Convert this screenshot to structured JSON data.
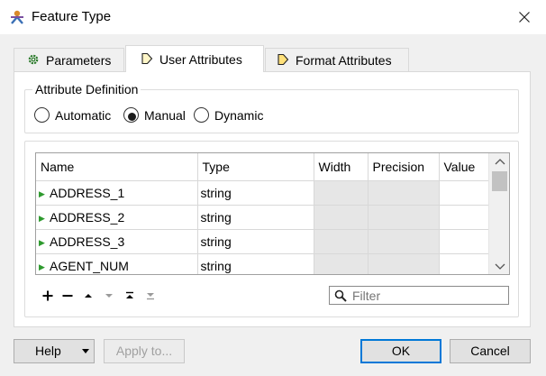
{
  "window": {
    "title": "Feature Type",
    "app_icon": "fme-workbench-icon",
    "close_icon": "close-icon"
  },
  "tabs": [
    {
      "label": "Parameters",
      "icon": "gear-icon",
      "active": false
    },
    {
      "label": "User Attributes",
      "icon": "tag-icon",
      "active": true
    },
    {
      "label": "Format Attributes",
      "icon": "tag-icon",
      "active": false
    }
  ],
  "attribute_definition": {
    "title": "Attribute Definition",
    "options": [
      {
        "label": "Automatic",
        "selected": false
      },
      {
        "label": "Manual",
        "selected": true
      },
      {
        "label": "Dynamic",
        "selected": false
      }
    ]
  },
  "table": {
    "columns": [
      "Name",
      "Type",
      "Width",
      "Precision",
      "Value"
    ],
    "rows": [
      {
        "name": "ADDRESS_1",
        "type": "string",
        "width": "",
        "precision": "",
        "value": ""
      },
      {
        "name": "ADDRESS_2",
        "type": "string",
        "width": "",
        "precision": "",
        "value": ""
      },
      {
        "name": "ADDRESS_3",
        "type": "string",
        "width": "",
        "precision": "",
        "value": ""
      },
      {
        "name": "AGENT_NUM",
        "type": "string",
        "width": "",
        "precision": "",
        "value": ""
      }
    ]
  },
  "toolbar": {
    "icons": [
      "plus-icon",
      "minus-icon",
      "move-up-icon",
      "move-down-icon",
      "move-top-icon",
      "move-bottom-icon"
    ]
  },
  "filter": {
    "placeholder": "Filter",
    "value": ""
  },
  "buttons": {
    "help": "Help",
    "apply": "Apply to...",
    "ok": "OK",
    "cancel": "Cancel"
  },
  "colors": {
    "accent": "#0078d7",
    "row_arrow": "#2e9a2e",
    "disabled_cell": "#e6e6e6"
  }
}
